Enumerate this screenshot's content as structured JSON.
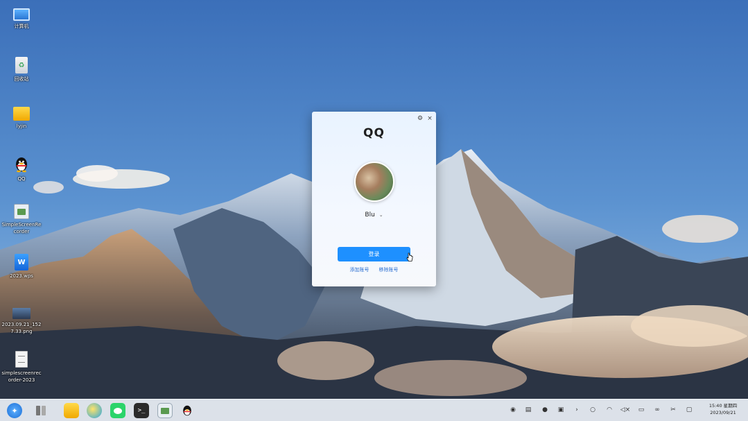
{
  "desktop": {
    "icons": [
      {
        "label": "计算机",
        "icon": "computer-icon"
      },
      {
        "label": "回收站",
        "icon": "trash-icon"
      },
      {
        "label": "lyjin",
        "icon": "folder-icon"
      },
      {
        "label": "QQ",
        "icon": "qq-penguin-icon"
      },
      {
        "label": "SimpleScreenRecorder",
        "icon": "screen-recorder-icon"
      },
      {
        "label": "2023.wps",
        "icon": "wps-document-icon"
      },
      {
        "label": "2023.09.21_1527.33.png",
        "icon": "image-file-icon"
      },
      {
        "label": "simplescreenrecorder-2023",
        "icon": "text-file-icon"
      }
    ]
  },
  "qq_window": {
    "title": "QQ",
    "settings_icon": "gear-icon",
    "close_label": "×",
    "account_name": "Blu",
    "login_label": "登录",
    "add_account_label": "添加账号",
    "remove_account_label": "移除账号",
    "accent": "#1e90ff"
  },
  "taskbar": {
    "apps": [
      "launcher-icon",
      "multitask-view-icon",
      "file-manager-icon",
      "browser-icon",
      "wechat-icon",
      "terminal-icon",
      "screen-recorder-icon",
      "qq-penguin-icon"
    ],
    "tray": [
      "color-picker-icon",
      "clipboard-icon",
      "qq-tray-icon",
      "screenshot-icon",
      "expand-arrow-icon",
      "search-icon",
      "wifi-icon",
      "mute-icon",
      "keyboard-icon",
      "link-icon",
      "scissors-icon",
      "notification-icon"
    ],
    "time": "15:40 星期四",
    "date": "2023/09/21"
  }
}
